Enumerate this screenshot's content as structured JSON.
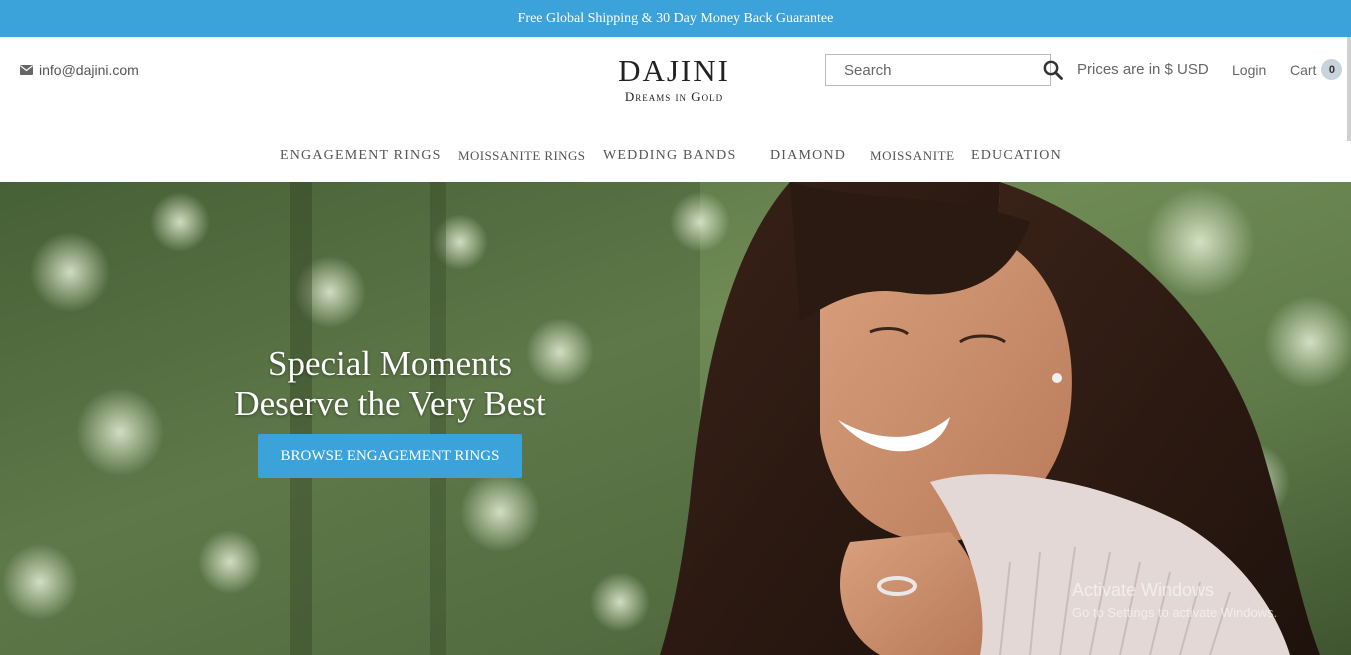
{
  "announcement": "Free Global Shipping & 30 Day Money Back Guarantee",
  "contact": {
    "email": "info@dajini.com",
    "icon": "envelope-icon"
  },
  "logo": {
    "name": "DAJINI",
    "tagline": "Dreams in Gold"
  },
  "search": {
    "placeholder": "Search",
    "icon": "search-icon"
  },
  "currency": "Prices are in $ USD",
  "login": "Login",
  "cart": {
    "label": "Cart",
    "count": "0"
  },
  "nav": [
    "ENGAGEMENT RINGS",
    "MOISSANITE RINGS",
    "WEDDING BANDS",
    "DIAMOND",
    "MOISSANITE",
    "EDUCATION"
  ],
  "hero": {
    "title_line1": "Special Moments",
    "title_line2": "Deserve the Very Best",
    "button": "BROWSE ENGAGEMENT RINGS"
  },
  "watermark": {
    "line1": "Activate Windows",
    "line2": "Go to Settings to activate Windows."
  },
  "colors": {
    "accent": "#3ba3d9",
    "badge": "#c9d3dc"
  }
}
